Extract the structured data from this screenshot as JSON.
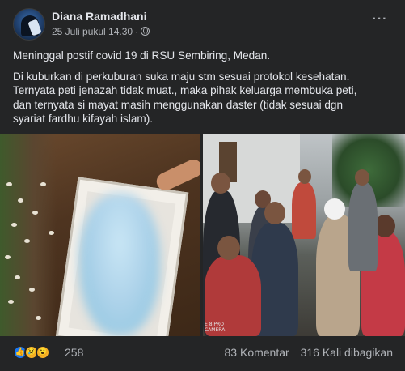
{
  "post": {
    "author": "Diana Ramadhani",
    "timestamp": "25 Juli pukul 14.30",
    "separator": "·",
    "privacy_icon": "globe-icon",
    "more_icon": "more-options-icon",
    "more_label": "···",
    "text_lines": [
      "Meninggal postif covid 19 di RSU Sembiring, Medan.",
      "Di kuburkan di perkuburan suka maju stm sesuai protokol kesehatan.",
      "Ternyata peti jenazah tidak muat., maka pihak keluarga membuka peti,",
      "dan ternyata si mayat masih menggunakan daster (tidak sesuai dgn",
      "syariat fardhu kifayah islam)."
    ],
    "photo_watermark": [
      "E 8 PRO",
      "CAMERA"
    ]
  },
  "footer": {
    "reactions": [
      {
        "icon": "like-reaction-icon",
        "glyph": "👍",
        "color": "#1877f2"
      },
      {
        "icon": "sad-reaction-icon",
        "glyph": "😢",
        "color": "#f7b125"
      },
      {
        "icon": "wow-reaction-icon",
        "glyph": "😮",
        "color": "#f7b125"
      }
    ],
    "reaction_count": "258",
    "comments": "83 Komentar",
    "shares": "316 Kali dibagikan"
  },
  "theme": {
    "background": "#242526",
    "text_primary": "#e4e6eb",
    "text_secondary": "#b0b3b8"
  }
}
